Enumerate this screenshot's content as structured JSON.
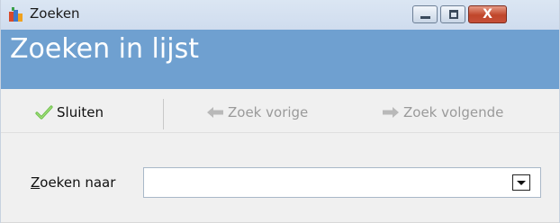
{
  "window": {
    "title": "Zoeken",
    "app_icon": "app-icon",
    "controls": {
      "minimize_icon": "minimize-icon",
      "maximize_icon": "maximize-icon",
      "close_glyph": "X"
    }
  },
  "header": {
    "title": "Zoeken in lijst",
    "background": "#6fa0d0"
  },
  "toolbar": {
    "items": [
      {
        "label": "Sluiten",
        "icon": "checkmark-icon",
        "enabled": true
      },
      {
        "label": "Zoek vorige",
        "icon": "arrow-left-icon",
        "enabled": false
      },
      {
        "label": "Zoek volgende",
        "icon": "arrow-right-icon",
        "enabled": false
      }
    ]
  },
  "form": {
    "search_label_accel": "Z",
    "search_label_rest": "oeken naar",
    "search_value": ""
  },
  "colors": {
    "disabled_text": "#9a9a9a",
    "check_green": "#6cc04a",
    "close_red": "#c0462a"
  }
}
